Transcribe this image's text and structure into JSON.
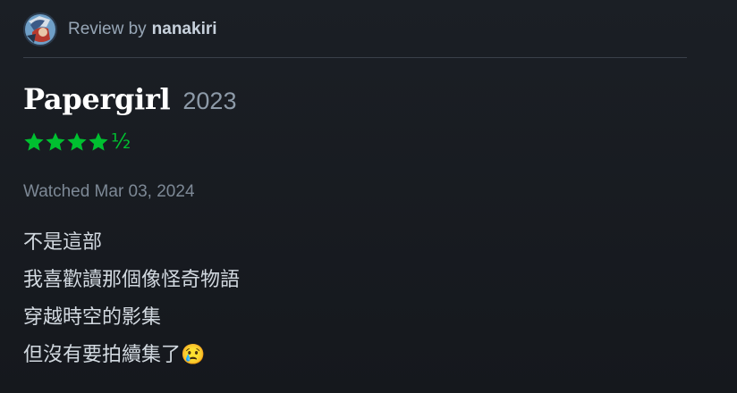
{
  "review": {
    "prefix": "Review by",
    "username": "nanakiri"
  },
  "film": {
    "title": "Papergirl",
    "year": "2023"
  },
  "rating": {
    "stars": 4.5,
    "max": 5,
    "half_glyph": "½",
    "color": "#00c030"
  },
  "watched": "Watched Mar 03, 2024",
  "body": {
    "lines": [
      "不是這部",
      "我喜歡讀那個像怪奇物語",
      "穿越時空的影集",
      "但沒有要拍續集了😢"
    ]
  },
  "colors": {
    "background": "#181c21",
    "accent": "#00c030"
  },
  "icons": {
    "avatar": "user-avatar",
    "star": "star-icon"
  }
}
